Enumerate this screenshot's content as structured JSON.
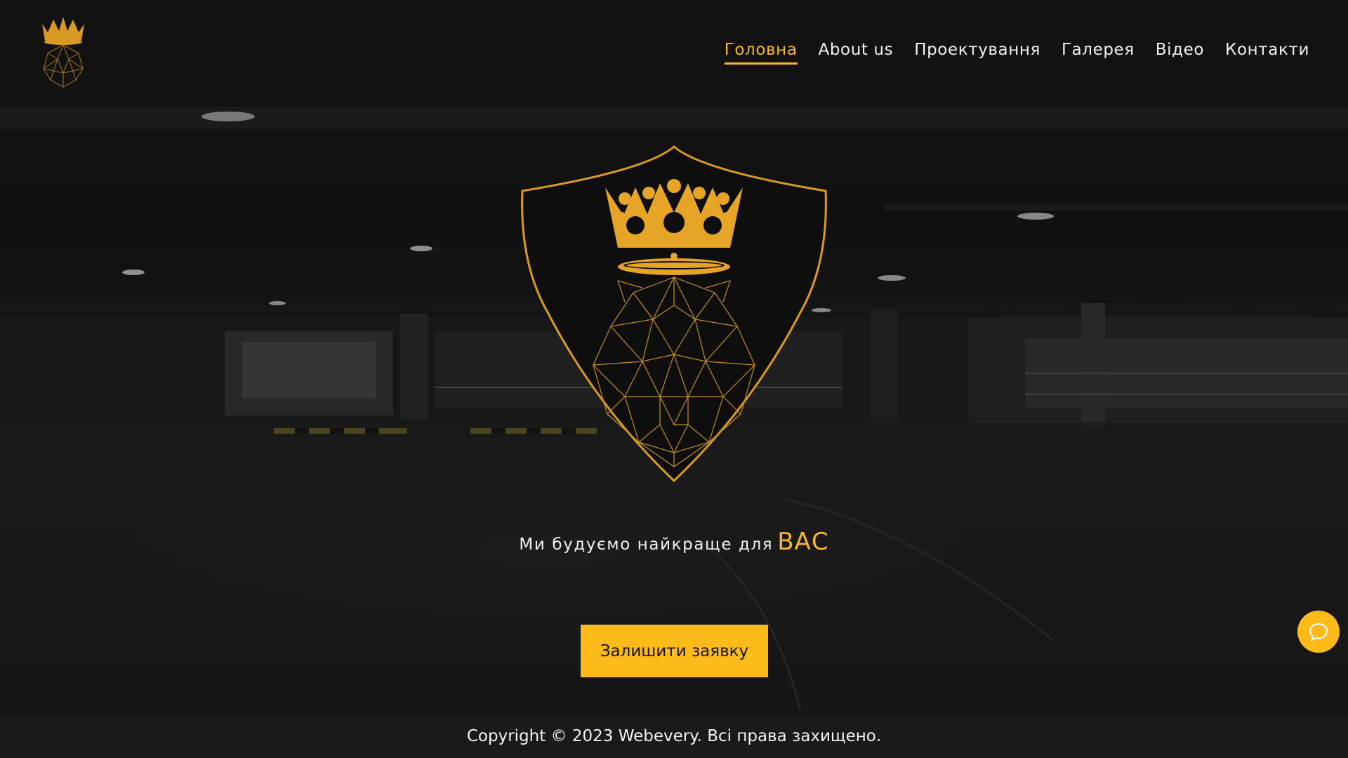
{
  "header": {
    "logo_icon": "crown-lion-logo-icon",
    "nav": [
      {
        "label": "Головна",
        "active": true
      },
      {
        "label": "About us",
        "active": false
      },
      {
        "label": "Проектування",
        "active": false
      },
      {
        "label": "Галерея",
        "active": false
      },
      {
        "label": "Відео",
        "active": false
      },
      {
        "label": "Контакти",
        "active": false
      }
    ]
  },
  "hero": {
    "emblem_icon": "shield-crown-lion-icon",
    "tagline_main": "Ми будуємо найкраще для",
    "tagline_accent": "ВАС",
    "cta_label": "Залишити заявку"
  },
  "chat": {
    "icon": "chat-bubble-icon"
  },
  "footer": {
    "copyright_prefix": "Copyright © 2023",
    "brand": "Webevery",
    "rights": ". Всі права захищено."
  },
  "colors": {
    "accent": "#fdbb1a",
    "gold": "#f6b72a",
    "header_bg": "#121212",
    "footer_bg": "#1a1a1a",
    "text": "#f1f1f1"
  }
}
